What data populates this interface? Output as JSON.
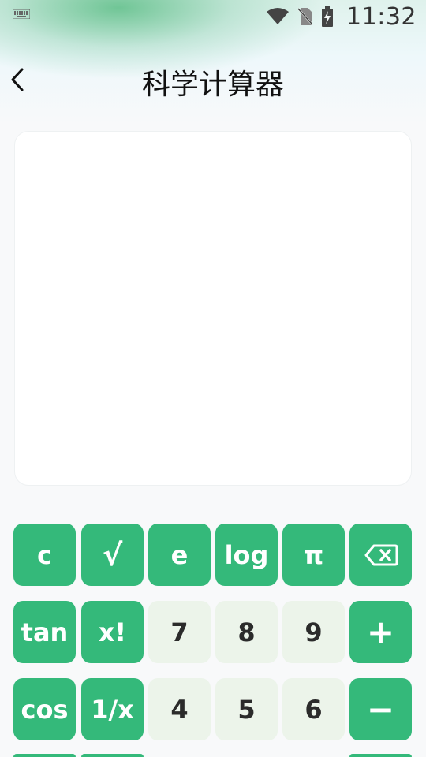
{
  "status_bar": {
    "time": "11:32"
  },
  "header": {
    "title": "科学计算器"
  },
  "display": {
    "expression": ""
  },
  "keypad": {
    "row1": [
      {
        "label": "c",
        "kind": "fn"
      },
      {
        "label": "√",
        "kind": "fn"
      },
      {
        "label": "e",
        "kind": "fn"
      },
      {
        "label": "log",
        "kind": "fn"
      },
      {
        "label": "π",
        "kind": "fn"
      },
      {
        "label": "",
        "kind": "fn",
        "icon": "backspace-icon"
      }
    ],
    "row2": [
      {
        "label": "tan",
        "kind": "fn"
      },
      {
        "label": "x!",
        "kind": "fn"
      },
      {
        "label": "7",
        "kind": "num"
      },
      {
        "label": "8",
        "kind": "num"
      },
      {
        "label": "9",
        "kind": "num"
      },
      {
        "label": "+",
        "kind": "fn"
      }
    ],
    "row3": [
      {
        "label": "cos",
        "kind": "fn"
      },
      {
        "label": "1/x",
        "kind": "fn"
      },
      {
        "label": "4",
        "kind": "num"
      },
      {
        "label": "5",
        "kind": "num"
      },
      {
        "label": "6",
        "kind": "num"
      },
      {
        "label": "−",
        "kind": "fn"
      }
    ]
  },
  "colors": {
    "accent": "#34b97a",
    "number_key": "#ecf4ea",
    "display_bg": "#ffffff"
  }
}
